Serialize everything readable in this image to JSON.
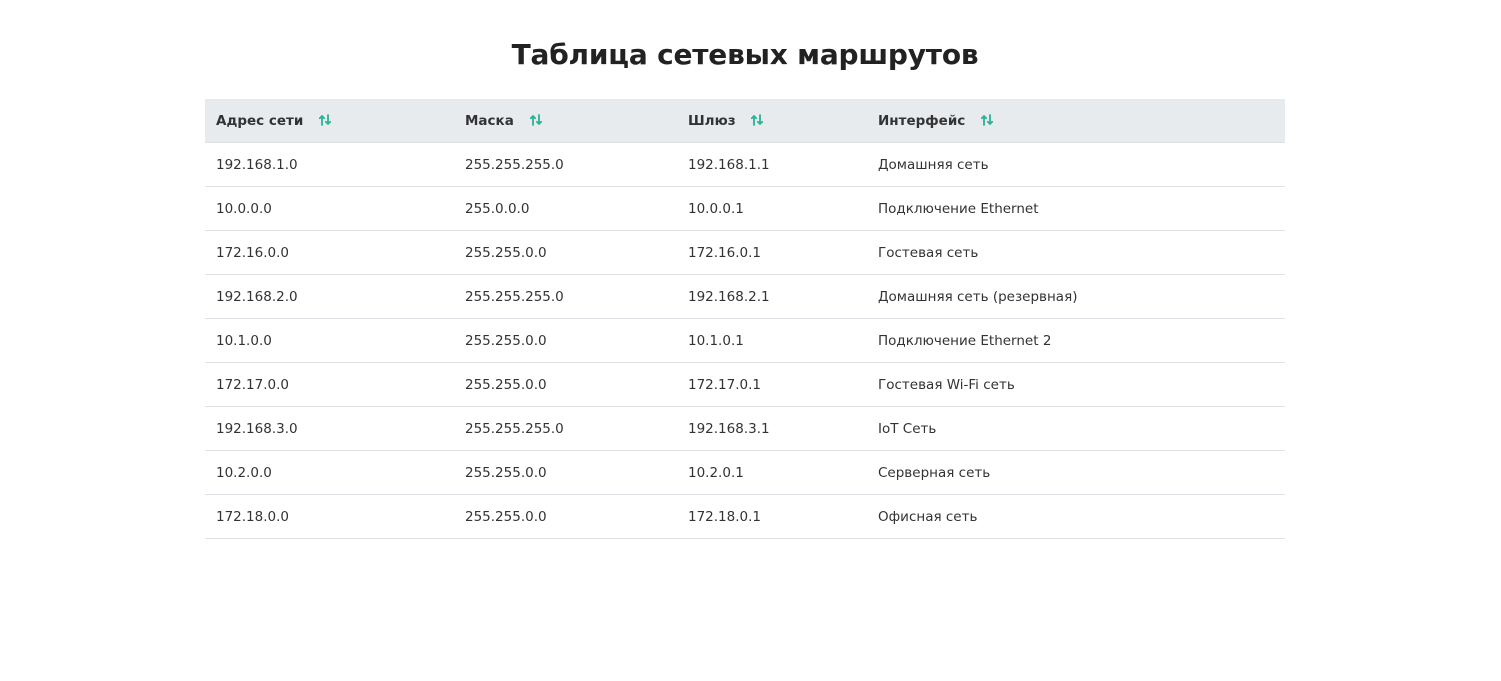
{
  "page": {
    "title": "Таблица сетевых маршрутов"
  },
  "colors": {
    "accent": "#2bb394",
    "header_bg": "#e8ebee",
    "row_border": "#dee2e6",
    "text": "#333333"
  },
  "table": {
    "columns": [
      {
        "label": "Адрес сети",
        "sort_icon": "sort-arrows-icon"
      },
      {
        "label": "Маска",
        "sort_icon": "sort-arrows-icon"
      },
      {
        "label": "Шлюз",
        "sort_icon": "sort-arrows-icon"
      },
      {
        "label": "Интерфейс",
        "sort_icon": "sort-arrows-icon"
      }
    ],
    "rows": [
      [
        "192.168.1.0",
        "255.255.255.0",
        "192.168.1.1",
        "Домашняя сеть"
      ],
      [
        "10.0.0.0",
        "255.0.0.0",
        "10.0.0.1",
        "Подключение Ethernet"
      ],
      [
        "172.16.0.0",
        "255.255.0.0",
        "172.16.0.1",
        "Гостевая сеть"
      ],
      [
        "192.168.2.0",
        "255.255.255.0",
        "192.168.2.1",
        "Домашняя сеть (резервная)"
      ],
      [
        "10.1.0.0",
        "255.255.0.0",
        "10.1.0.1",
        "Подключение Ethernet 2"
      ],
      [
        "172.17.0.0",
        "255.255.0.0",
        "172.17.0.1",
        "Гостевая Wi-Fi сеть"
      ],
      [
        "192.168.3.0",
        "255.255.255.0",
        "192.168.3.1",
        "IoT Сеть"
      ],
      [
        "10.2.0.0",
        "255.255.0.0",
        "10.2.0.1",
        "Серверная сеть"
      ],
      [
        "172.18.0.0",
        "255.255.0.0",
        "172.18.0.1",
        "Офисная сеть"
      ]
    ]
  }
}
